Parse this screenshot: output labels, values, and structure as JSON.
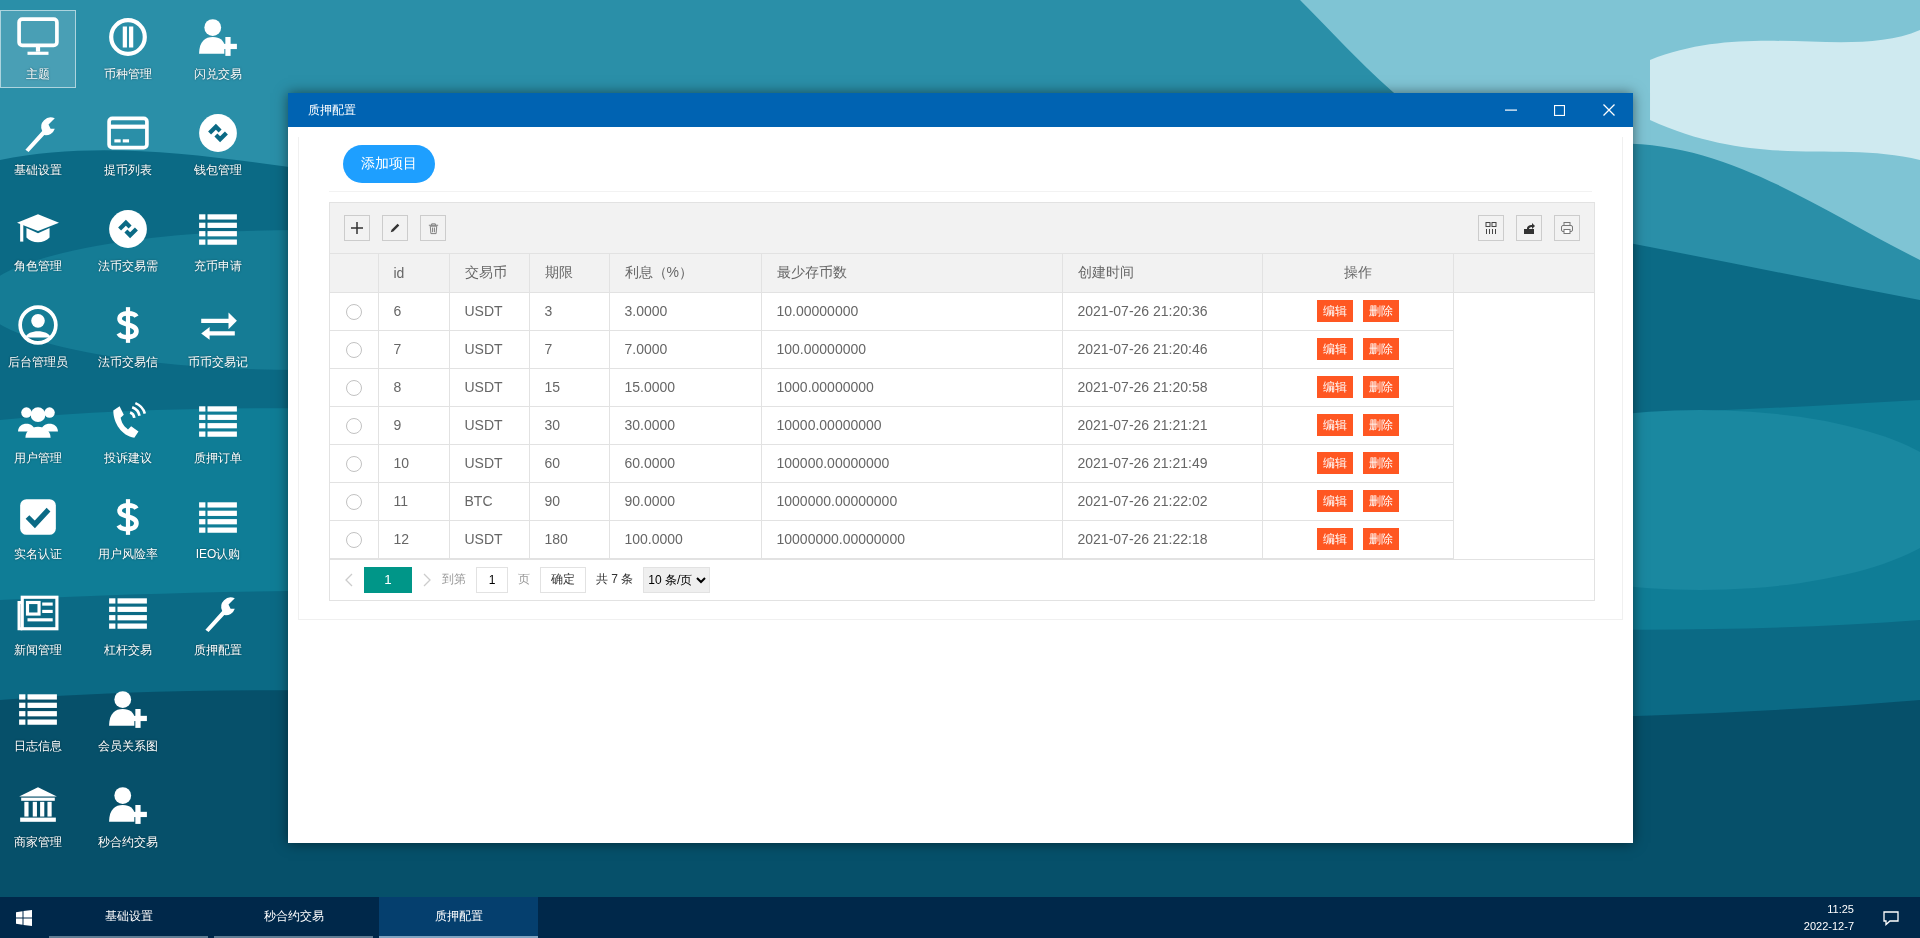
{
  "desktop": {
    "rows": [
      [
        {
          "label": "主题",
          "selected": true
        },
        {
          "label": "币种管理",
          "selected": false
        },
        {
          "label": "闪兑交易",
          "selected": false
        }
      ],
      [
        {
          "label": "基础设置",
          "selected": false
        },
        {
          "label": "提币列表",
          "selected": false
        },
        {
          "label": "钱包管理",
          "selected": false
        }
      ],
      [
        {
          "label": "角色管理",
          "selected": false
        },
        {
          "label": "法币交易需",
          "selected": false
        },
        {
          "label": "充币申请",
          "selected": false
        }
      ],
      [
        {
          "label": "后台管理员",
          "selected": false
        },
        {
          "label": "法币交易信",
          "selected": false
        },
        {
          "label": "币币交易记",
          "selected": false
        }
      ],
      [
        {
          "label": "用户管理",
          "selected": false
        },
        {
          "label": "投诉建议",
          "selected": false
        },
        {
          "label": "质押订单",
          "selected": false
        }
      ],
      [
        {
          "label": "实名认证",
          "selected": false
        },
        {
          "label": "用户风险率",
          "selected": false
        },
        {
          "label": "IEO认购",
          "selected": false
        }
      ],
      [
        {
          "label": "新闻管理",
          "selected": false
        },
        {
          "label": "杠杆交易",
          "selected": false
        },
        {
          "label": "质押配置",
          "selected": false
        }
      ],
      [
        {
          "label": "日志信息",
          "selected": false
        },
        {
          "label": "会员关系图",
          "selected": false
        }
      ],
      [
        {
          "label": "商家管理",
          "selected": false
        },
        {
          "label": "秒合约交易",
          "selected": false
        }
      ]
    ]
  },
  "window": {
    "title": "质押配置",
    "add_button": "添加项目",
    "table": {
      "columns": [
        "id",
        "交易币",
        "期限",
        "利息（%）",
        "最少存币数",
        "创建时间",
        "操作"
      ],
      "rows": [
        {
          "selected": false,
          "cells": [
            "6",
            "USDT",
            "3",
            "3.0000",
            "10.00000000",
            "2021-07-26 21:20:36"
          ],
          "actions": [
            "编辑",
            "删除"
          ]
        },
        {
          "selected": false,
          "cells": [
            "7",
            "USDT",
            "7",
            "7.0000",
            "100.00000000",
            "2021-07-26 21:20:46"
          ],
          "actions": [
            "编辑",
            "删除"
          ]
        },
        {
          "selected": false,
          "cells": [
            "8",
            "USDT",
            "15",
            "15.0000",
            "1000.00000000",
            "2021-07-26 21:20:58"
          ],
          "actions": [
            "编辑",
            "删除"
          ]
        },
        {
          "selected": false,
          "cells": [
            "9",
            "USDT",
            "30",
            "30.0000",
            "10000.00000000",
            "2021-07-26 21:21:21"
          ],
          "actions": [
            "编辑",
            "删除"
          ]
        },
        {
          "selected": false,
          "cells": [
            "10",
            "USDT",
            "60",
            "60.0000",
            "100000.00000000",
            "2021-07-26 21:21:49"
          ],
          "actions": [
            "编辑",
            "删除"
          ]
        },
        {
          "selected": false,
          "cells": [
            "11",
            "BTC",
            "90",
            "90.0000",
            "1000000.00000000",
            "2021-07-26 21:22:02"
          ],
          "actions": [
            "编辑",
            "删除"
          ]
        },
        {
          "selected": false,
          "cells": [
            "12",
            "USDT",
            "180",
            "100.0000",
            "10000000.00000000",
            "2021-07-26 21:22:18"
          ],
          "actions": [
            "编辑",
            "删除"
          ]
        }
      ]
    },
    "pagination": {
      "pages": [
        {
          "label": "1",
          "selected": true
        }
      ],
      "goto_label": "到第",
      "goto_value": "1",
      "page_unit": "页",
      "confirm": "确定",
      "total": "共 7 条",
      "page_size": "10 条/页"
    }
  },
  "taskbar": {
    "tasks": [
      {
        "label": "基础设置",
        "selected": false
      },
      {
        "label": "秒合约交易",
        "selected": false
      },
      {
        "label": "质押配置",
        "selected": true
      }
    ],
    "time": "11:25",
    "date": "2022-12-7"
  }
}
